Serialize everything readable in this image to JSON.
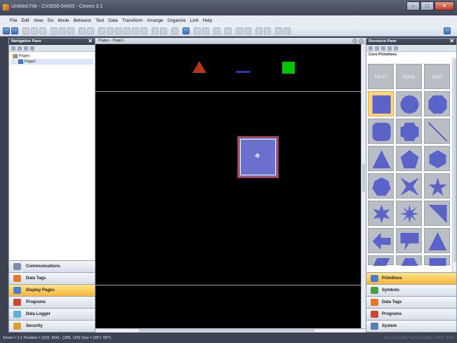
{
  "window": {
    "title": "Untitled File - CV3000-04000 - Cimrex 3.1",
    "min": "–",
    "max": "□",
    "close": "✕"
  },
  "menu": [
    "File",
    "Edit",
    "View",
    "Go",
    "Mode",
    "Behavior",
    "Text",
    "Data",
    "Transform",
    "Arrange",
    "Organize",
    "Link",
    "Help"
  ],
  "nav": {
    "header": "Navigation Pane",
    "close": "✕",
    "tree": {
      "root": "Pages",
      "child": "Page1"
    },
    "buttons": [
      {
        "label": "Communications",
        "active": false,
        "color": "#7d8db0"
      },
      {
        "label": "Data Tags",
        "active": false,
        "color": "#e47a28"
      },
      {
        "label": "Display Pages",
        "active": true,
        "color": "#4a7fd0"
      },
      {
        "label": "Programs",
        "active": false,
        "color": "#c84830"
      },
      {
        "label": "Data Logger",
        "active": false,
        "color": "#5fb0d8"
      },
      {
        "label": "Security",
        "active": false,
        "color": "#d8a030"
      }
    ]
  },
  "pages": {
    "header": "Pages - Page1"
  },
  "resource": {
    "header": "Resource Pane",
    "close": "✕",
    "section": "Core Primitives",
    "tiles": [
      "TEXT",
      "0000",
      "IMG"
    ],
    "shape_color": "#5b62c8",
    "buttons": [
      {
        "label": "Primitives",
        "active": true,
        "color": "#4a7fd0"
      },
      {
        "label": "Symbols",
        "active": false,
        "color": "#4aa048"
      },
      {
        "label": "Data Tags",
        "active": false,
        "color": "#e47a28"
      },
      {
        "label": "Programs",
        "active": false,
        "color": "#c84830"
      },
      {
        "label": "System",
        "active": false,
        "color": "#5a7ab8"
      }
    ]
  },
  "status": {
    "text": "Zoom = 1:1  Position = (232, 664) - (288, 120)  Size = (057, 057)",
    "right": "Direct Circular Terminal Note CAPS NUM"
  }
}
